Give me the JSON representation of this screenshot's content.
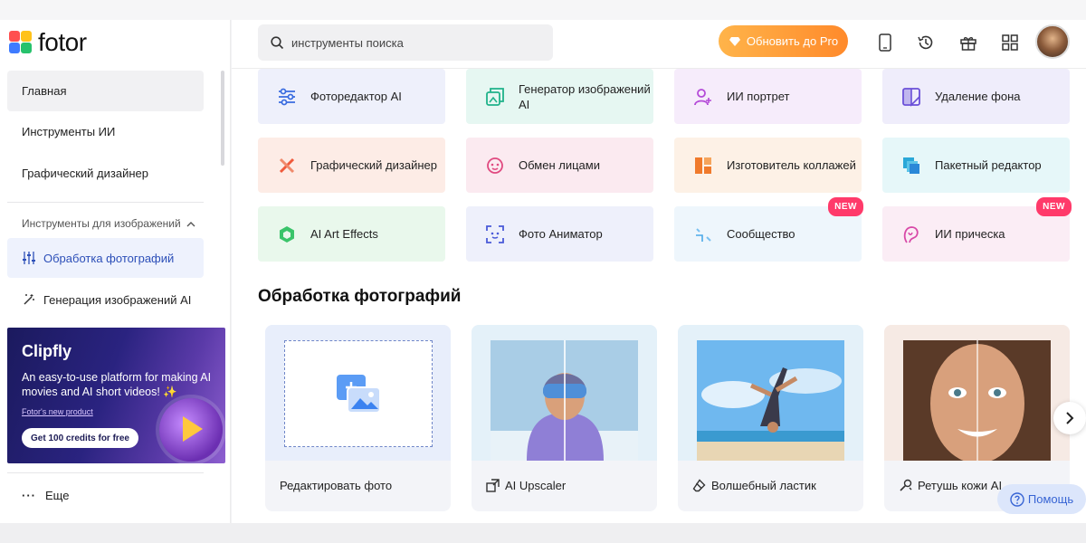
{
  "brand": {
    "logo_text": "fotor"
  },
  "sidebar": {
    "items": [
      {
        "label": "Главная"
      },
      {
        "label": "Инструменты ИИ"
      },
      {
        "label": "Графический дизайнер"
      }
    ],
    "section_label": "Инструменты для изображений",
    "sub_items": [
      {
        "label": "Обработка фотографий"
      },
      {
        "label": "Генерация изображений AI"
      }
    ],
    "promo": {
      "title": "Clipfly",
      "description": "An easy-to-use platform for making AI movies and AI short videos! ✨",
      "link": "Fotor's new product",
      "button": "Get 100 credits for free"
    },
    "more_label": "Еще"
  },
  "header": {
    "search_placeholder": "инструменты поиска",
    "pro_button": "Обновить до Pro"
  },
  "tools": [
    {
      "label": "Фоторедактор AI",
      "bg": "#eef0fb",
      "icon": "sliders-icon"
    },
    {
      "label": "Генератор изображений AI",
      "bg": "#e6f7f2",
      "icon": "image-generator-icon"
    },
    {
      "label": "ИИ портрет",
      "bg": "#f6ecfb",
      "icon": "portrait-icon"
    },
    {
      "label": "Удаление фона",
      "bg": "#efedfb",
      "icon": "background-remove-icon"
    },
    {
      "label": "Графический дизайнер",
      "bg": "#fdece6",
      "icon": "design-tools-icon"
    },
    {
      "label": "Обмен лицами",
      "bg": "#fbeaf0",
      "icon": "face-swap-icon"
    },
    {
      "label": "Изготовитель коллажей",
      "bg": "#fdf1e6",
      "icon": "collage-icon"
    },
    {
      "label": "Пакетный редактор",
      "bg": "#e6f7f9",
      "icon": "batch-icon"
    },
    {
      "label": "AI Art Effects",
      "bg": "#e9f8ec",
      "icon": "art-effects-icon"
    },
    {
      "label": "Фото Аниматор",
      "bg": "#eef0fb",
      "icon": "animator-icon"
    },
    {
      "label": "Сообщество",
      "bg": "#eef6fc",
      "icon": "community-icon",
      "badge": "NEW"
    },
    {
      "label": "ИИ прическа",
      "bg": "#fbedf5",
      "icon": "hairstyle-icon",
      "badge": "NEW"
    }
  ],
  "section_title": "Обработка фотографий",
  "photo_cards": [
    {
      "label": "Редактировать фото"
    },
    {
      "label": "AI Upscaler"
    },
    {
      "label": "Волшебный ластик"
    },
    {
      "label": "Ретушь кожи AI"
    }
  ],
  "help_label": "Помощь"
}
